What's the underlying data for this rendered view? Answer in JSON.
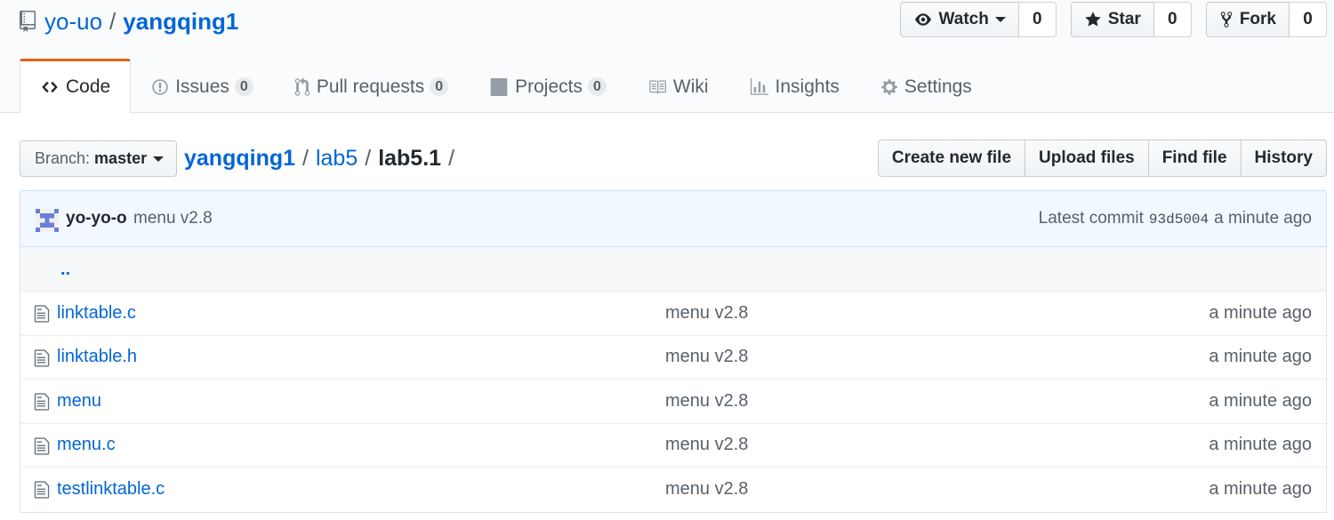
{
  "repo": {
    "owner": "yo-uo",
    "separator": "/",
    "name": "yangqing1"
  },
  "actions": {
    "watch": {
      "label": "Watch",
      "count": "0"
    },
    "star": {
      "label": "Star",
      "count": "0"
    },
    "fork": {
      "label": "Fork",
      "count": "0"
    }
  },
  "tabs": [
    {
      "label": "Code",
      "icon": "code-icon"
    },
    {
      "label": "Issues",
      "count": "0",
      "icon": "issue-icon"
    },
    {
      "label": "Pull requests",
      "count": "0",
      "icon": "pull-request-icon"
    },
    {
      "label": "Projects",
      "count": "0",
      "icon": "project-icon"
    },
    {
      "label": "Wiki",
      "icon": "book-icon"
    },
    {
      "label": "Insights",
      "icon": "graph-icon"
    },
    {
      "label": "Settings",
      "icon": "gear-icon"
    }
  ],
  "branch": {
    "label": "Branch:",
    "value": "master"
  },
  "breadcrumb": {
    "root": "yangqing1",
    "dir": "lab5",
    "current": "lab5.1",
    "slash": "/"
  },
  "file_actions": {
    "create": "Create new file",
    "upload": "Upload files",
    "find": "Find file",
    "history": "History"
  },
  "commit": {
    "author": "yo-yo-o",
    "message": "menu v2.8",
    "latest_label": "Latest commit",
    "sha": "93d5004",
    "age": "a minute ago"
  },
  "up_dir": "..",
  "files": [
    {
      "name": "linktable.c",
      "message": "menu v2.8",
      "age": "a minute ago"
    },
    {
      "name": "linktable.h",
      "message": "menu v2.8",
      "age": "a minute ago"
    },
    {
      "name": "menu",
      "message": "menu v2.8",
      "age": "a minute ago"
    },
    {
      "name": "menu.c",
      "message": "menu v2.8",
      "age": "a minute ago"
    },
    {
      "name": "testlinktable.c",
      "message": "menu v2.8",
      "age": "a minute ago"
    }
  ],
  "colors": {
    "link": "#0366d6",
    "tab_accent": "#e36209",
    "commit_bg": "#f1f8ff",
    "muted": "#586069"
  }
}
